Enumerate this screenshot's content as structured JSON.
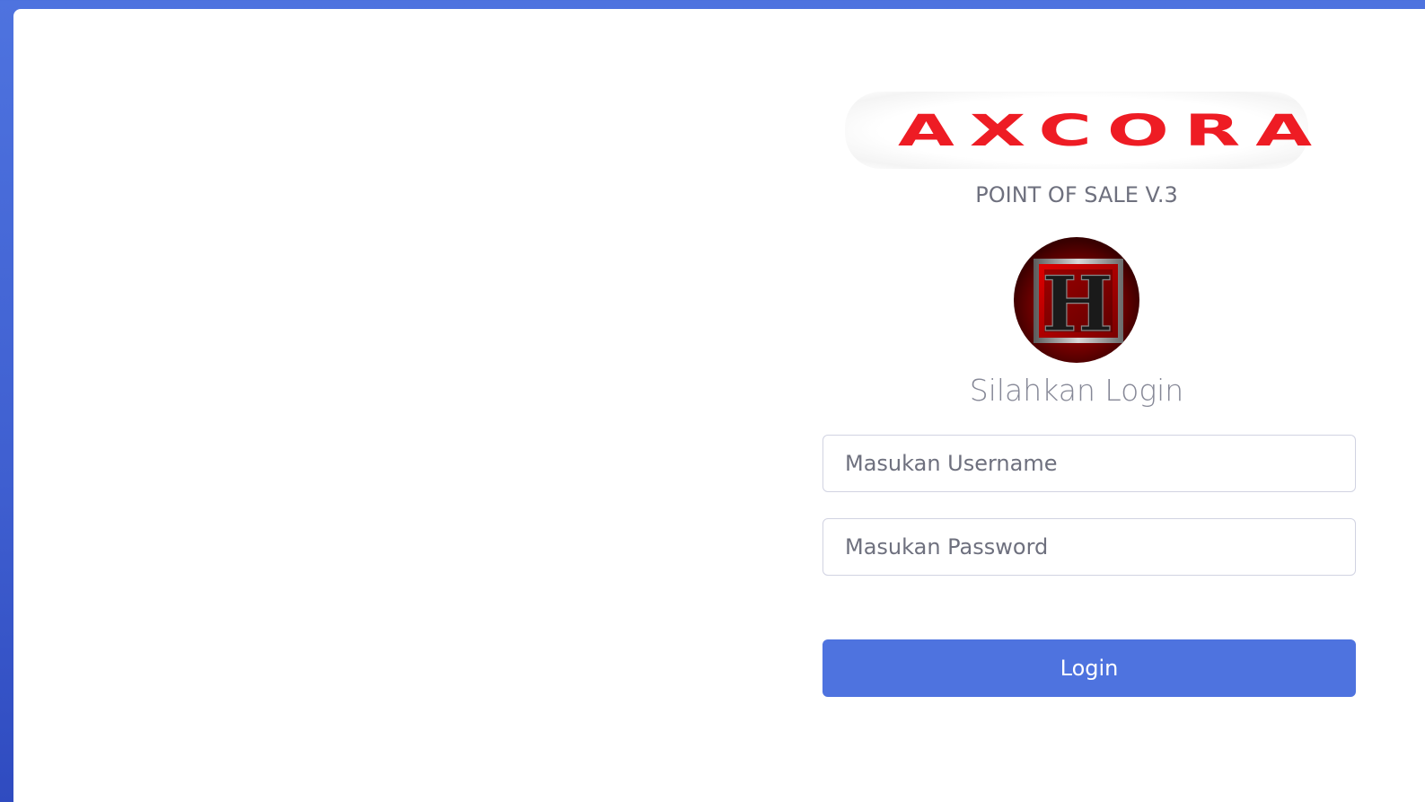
{
  "brand": {
    "logo_text": "AXCORA",
    "logo_color": "#ee1c24"
  },
  "app": {
    "subtitle": "POINT OF SALE V.3"
  },
  "avatar": {
    "letter": "H"
  },
  "login": {
    "heading": "Silahkan Login",
    "username_placeholder": "Masukan Username",
    "password_placeholder": "Masukan Password",
    "button_label": "Login"
  },
  "colors": {
    "primary": "#4e73df",
    "background": "#4e73df",
    "card": "#ffffff",
    "text_muted": "#858796"
  }
}
